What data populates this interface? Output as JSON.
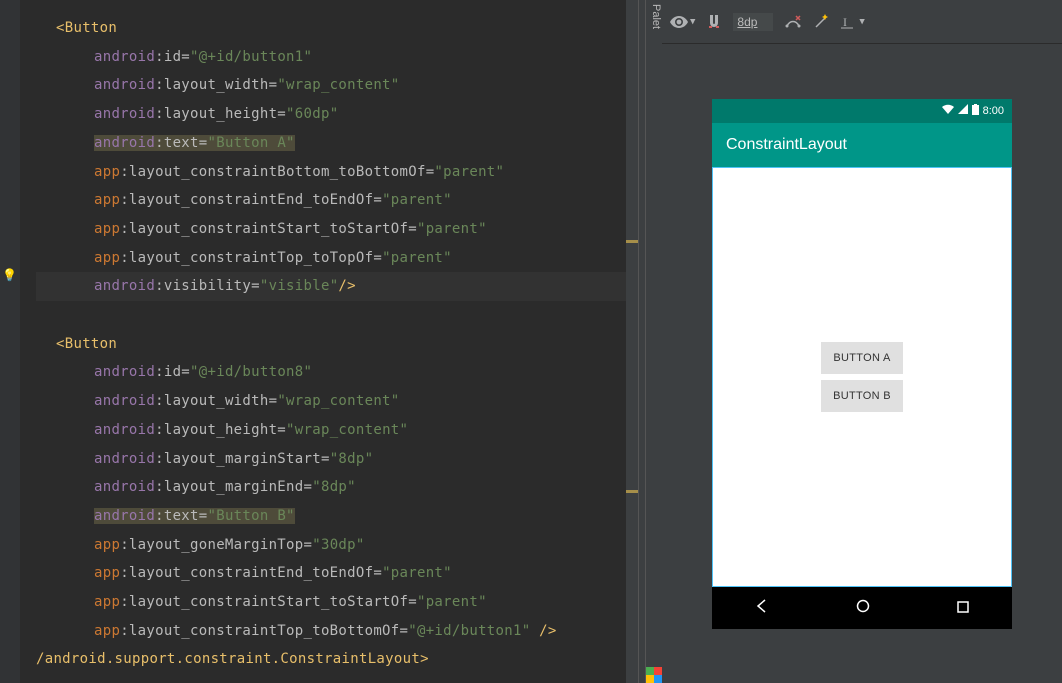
{
  "toolbar": {
    "dp_value": "8dp"
  },
  "code": {
    "button1": {
      "tag": "Button",
      "id_attr": ":id=",
      "id_val": "\"@+id/button1\"",
      "width_attr": ":layout_width=",
      "width_val": "\"wrap_content\"",
      "height_attr": ":layout_height=",
      "height_val": "\"60dp\"",
      "text_attr": ":text=",
      "text_val": "\"Button A\"",
      "cb_attr": ":layout_constraintBottom_toBottomOf=",
      "cb_val": "\"parent\"",
      "ce_attr": ":layout_constraintEnd_toEndOf=",
      "ce_val": "\"parent\"",
      "cs_attr": ":layout_constraintStart_toStartOf=",
      "cs_val": "\"parent\"",
      "ct_attr": ":layout_constraintTop_toTopOf=",
      "ct_val": "\"parent\"",
      "vis_attr": ":visibility=",
      "vis_val": "\"visible\"",
      "close": "/>"
    },
    "button8": {
      "tag": "Button",
      "id_attr": ":id=",
      "id_val": "\"@+id/button8\"",
      "width_attr": ":layout_width=",
      "width_val": "\"wrap_content\"",
      "height_attr": ":layout_height=",
      "height_val": "\"wrap_content\"",
      "ms_attr": ":layout_marginStart=",
      "ms_val": "\"8dp\"",
      "me_attr": ":layout_marginEnd=",
      "me_val": "\"8dp\"",
      "text_attr": ":text=",
      "text_val": "\"Button B\"",
      "gm_attr": ":layout_goneMarginTop=",
      "gm_val": "\"30dp\"",
      "ce_attr": ":layout_constraintEnd_toEndOf=",
      "ce_val": "\"parent\"",
      "cs_attr": ":layout_constraintStart_toStartOf=",
      "cs_val": "\"parent\"",
      "ctb_attr": ":layout_constraintTop_toBottomOf=",
      "ctb_val": "\"@+id/button1\"",
      "space_close": " />"
    },
    "close_tag": "/android.support.constraint.ConstraintLayout>",
    "ns_android": "android",
    "ns_app": "app",
    "lt": "<"
  },
  "palette_label": "Palet",
  "preview": {
    "status_time": "8:00",
    "app_title": "ConstraintLayout",
    "button_a": "BUTTON A",
    "button_b": "BUTTON B"
  }
}
